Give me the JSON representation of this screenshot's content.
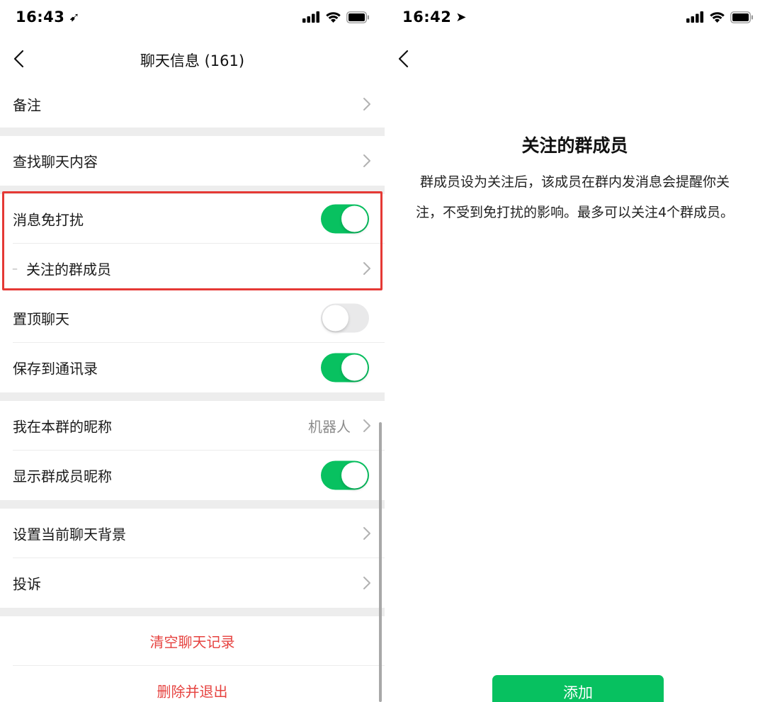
{
  "left_screen": {
    "status": {
      "time": "16:43",
      "arrow": "➹"
    },
    "nav": {
      "title": "聊天信息 (161)"
    },
    "rows": {
      "remark": "备注",
      "search_history": "查找聊天内容",
      "mute": {
        "label": "消息免打扰",
        "on": true
      },
      "starred_members": {
        "dash": "–",
        "label": "关注的群成员"
      },
      "sticky": {
        "label": "置顶聊天",
        "on": false
      },
      "save_contacts": {
        "label": "保存到通讯录",
        "on": true
      },
      "my_alias": {
        "label": "我在本群的昵称",
        "value": "机器人"
      },
      "show_names": {
        "label": "显示群成员昵称",
        "on": true
      },
      "background": "设置当前聊天背景",
      "report": "投诉",
      "clear_history": "清空聊天记录",
      "delete_exit": "删除并退出"
    }
  },
  "right_screen": {
    "status": {
      "time": "16:42",
      "arrow": "➤"
    },
    "title": "关注的群成员",
    "description": "群成员设为关注后，该成员在群内发消息会提醒你关注，不受到免打扰的影响。最多可以关注4个群成员。",
    "add_button": "添加"
  },
  "colors": {
    "toggle_on": "#08c160",
    "toggle_off": "#e9e9ea",
    "danger_text": "#e64340",
    "highlight_border": "#e53935",
    "primary_button": "#07c160",
    "section_gap": "#ededed"
  },
  "icons": [
    "back-arrow-icon",
    "chevron-right-icon",
    "signal-icon",
    "wifi-icon",
    "battery-icon",
    "location-arrow-icon"
  ]
}
